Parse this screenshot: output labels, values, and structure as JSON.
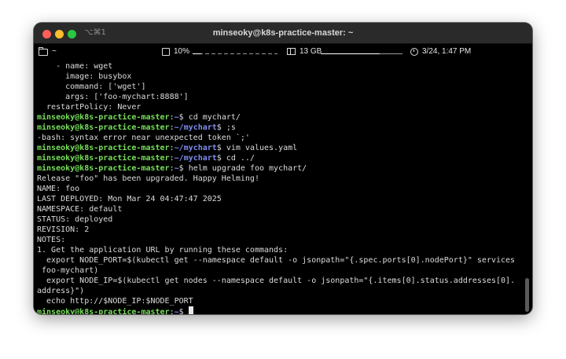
{
  "window": {
    "shortcut": "⌥⌘1",
    "title": "minseoky@k8s-practice-master: ~"
  },
  "statusbar": {
    "cwd": "~",
    "cpu": "10%",
    "cpu_fraction": 0.1,
    "memory": "13 GB",
    "memory_fraction": 0.72,
    "datetime": "3/24, 1:47 PM"
  },
  "prompt": {
    "user_host": "minseoky@k8s-practice-master",
    "sep": ":",
    "end": "$ "
  },
  "lines": [
    {
      "type": "out",
      "text": "    - name: wget"
    },
    {
      "type": "out",
      "text": "      image: busybox"
    },
    {
      "type": "out",
      "text": "      command: ['wget']"
    },
    {
      "type": "out",
      "text": "      args: ['foo-mychart:8888']"
    },
    {
      "type": "out",
      "text": "  restartPolicy: Never"
    },
    {
      "type": "cmd",
      "path": "~",
      "text": "cd mychart/"
    },
    {
      "type": "cmd",
      "path": "~/mychart",
      "text": ";s"
    },
    {
      "type": "out",
      "text": "-bash: syntax error near unexpected token `;'"
    },
    {
      "type": "cmd",
      "path": "~/mychart",
      "text": "vim values.yaml"
    },
    {
      "type": "cmd",
      "path": "~/mychart",
      "text": "cd ../"
    },
    {
      "type": "cmd",
      "path": "~",
      "text": "helm upgrade foo mychart/"
    },
    {
      "type": "out",
      "text": "Release \"foo\" has been upgraded. Happy Helming!"
    },
    {
      "type": "out",
      "text": "NAME: foo"
    },
    {
      "type": "out",
      "text": "LAST DEPLOYED: Mon Mar 24 04:47:47 2025"
    },
    {
      "type": "out",
      "text": "NAMESPACE: default"
    },
    {
      "type": "out",
      "text": "STATUS: deployed"
    },
    {
      "type": "out",
      "text": "REVISION: 2"
    },
    {
      "type": "out",
      "text": "NOTES:"
    },
    {
      "type": "out",
      "text": "1. Get the application URL by running these commands:"
    },
    {
      "type": "out",
      "text": "  export NODE_PORT=$(kubectl get --namespace default -o jsonpath=\"{.spec.ports[0].nodePort}\" services"
    },
    {
      "type": "out",
      "text": " foo-mychart)"
    },
    {
      "type": "out",
      "text": "  export NODE_IP=$(kubectl get nodes --namespace default -o jsonpath=\"{.items[0].status.addresses[0]."
    },
    {
      "type": "out",
      "text": "address}\")"
    },
    {
      "type": "out",
      "text": "  echo http://$NODE_IP:$NODE_PORT"
    },
    {
      "type": "cmd",
      "path": "~",
      "text": "",
      "cursor": true
    }
  ]
}
